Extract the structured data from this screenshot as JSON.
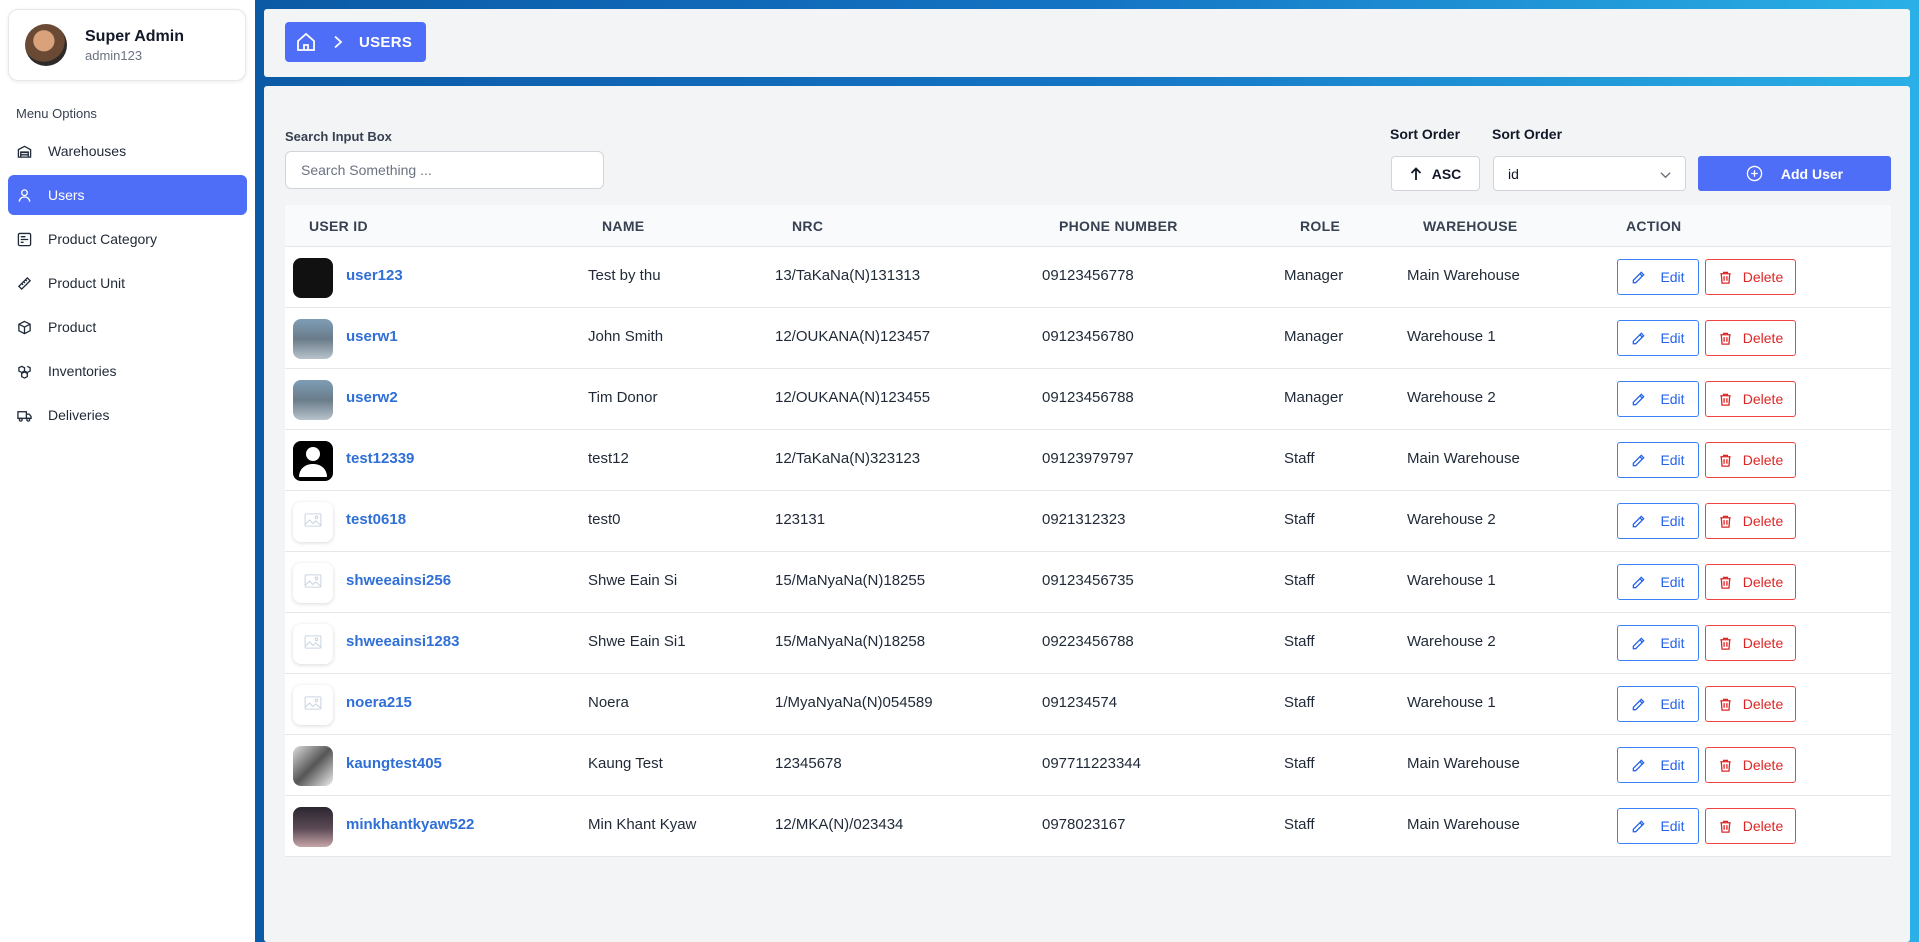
{
  "profile": {
    "name": "Super Admin",
    "username": "admin123"
  },
  "menu": {
    "title": "Menu Options",
    "items": [
      {
        "label": "Warehouses",
        "icon": "warehouse-icon",
        "active": false
      },
      {
        "label": "Users",
        "icon": "user-icon",
        "active": true
      },
      {
        "label": "Product Category",
        "icon": "category-icon",
        "active": false
      },
      {
        "label": "Product Unit",
        "icon": "ruler-icon",
        "active": false
      },
      {
        "label": "Product",
        "icon": "box-icon",
        "active": false
      },
      {
        "label": "Inventories",
        "icon": "boxes-icon",
        "active": false
      },
      {
        "label": "Deliveries",
        "icon": "truck-icon",
        "active": false
      }
    ]
  },
  "breadcrumb": {
    "current": "USERS"
  },
  "search": {
    "label": "Search Input Box",
    "placeholder": "Search Something ...",
    "value": ""
  },
  "sort": {
    "direction_label": "Sort Order",
    "direction_value": "ASC",
    "field_label": "Sort Order",
    "field_value": "id"
  },
  "add_button": "Add User",
  "table": {
    "headers": {
      "user_id": "USER ID",
      "name": "NAME",
      "nrc": "NRC",
      "phone": "PHONE NUMBER",
      "role": "ROLE",
      "warehouse": "WAREHOUSE",
      "action": "ACTION"
    },
    "edit_label": "Edit",
    "delete_label": "Delete",
    "rows": [
      {
        "user_id": "user123",
        "name": "Test by thu",
        "nrc": "13/TaKaNa(N)131313",
        "phone": "09123456778",
        "role": "Manager",
        "warehouse": "Main Warehouse"
      },
      {
        "user_id": "userw1",
        "name": "John Smith",
        "nrc": "12/OUKANA(N)123457",
        "phone": "09123456780",
        "role": "Manager",
        "warehouse": "Warehouse 1"
      },
      {
        "user_id": "userw2",
        "name": "Tim Donor",
        "nrc": "12/OUKANA(N)123455",
        "phone": "09123456788",
        "role": "Manager",
        "warehouse": "Warehouse 2"
      },
      {
        "user_id": "test12339",
        "name": "test12",
        "nrc": "12/TaKaNa(N)323123",
        "phone": "09123979797",
        "role": "Staff",
        "warehouse": "Main Warehouse"
      },
      {
        "user_id": "test0618",
        "name": "test0",
        "nrc": "123131",
        "phone": "0921312323",
        "role": "Staff",
        "warehouse": "Warehouse 2"
      },
      {
        "user_id": "shweeainsi256",
        "name": "Shwe Eain Si",
        "nrc": "15/MaNyaNa(N)18255",
        "phone": "09123456735",
        "role": "Staff",
        "warehouse": "Warehouse 1"
      },
      {
        "user_id": "shweeainsi1283",
        "name": "Shwe Eain Si1",
        "nrc": "15/MaNyaNa(N)18258",
        "phone": "09223456788",
        "role": "Staff",
        "warehouse": "Warehouse 2"
      },
      {
        "user_id": "noera215",
        "name": "Noera",
        "nrc": "1/MyaNyaNa(N)054589",
        "phone": "091234574",
        "role": "Staff",
        "warehouse": "Warehouse 1"
      },
      {
        "user_id": "kaungtest405",
        "name": "Kaung Test",
        "nrc": "12345678",
        "phone": "097711223344",
        "role": "Staff",
        "warehouse": "Main Warehouse"
      },
      {
        "user_id": "minkhantkyaw522",
        "name": "Min Khant Kyaw",
        "nrc": "12/MKA(N)/023434",
        "phone": "0978023167",
        "role": "Staff",
        "warehouse": "Main Warehouse"
      }
    ]
  },
  "colors": {
    "accent": "#4f6ef7",
    "link": "#2f6fd6",
    "danger": "#dc2626",
    "edit": "#2563eb"
  }
}
